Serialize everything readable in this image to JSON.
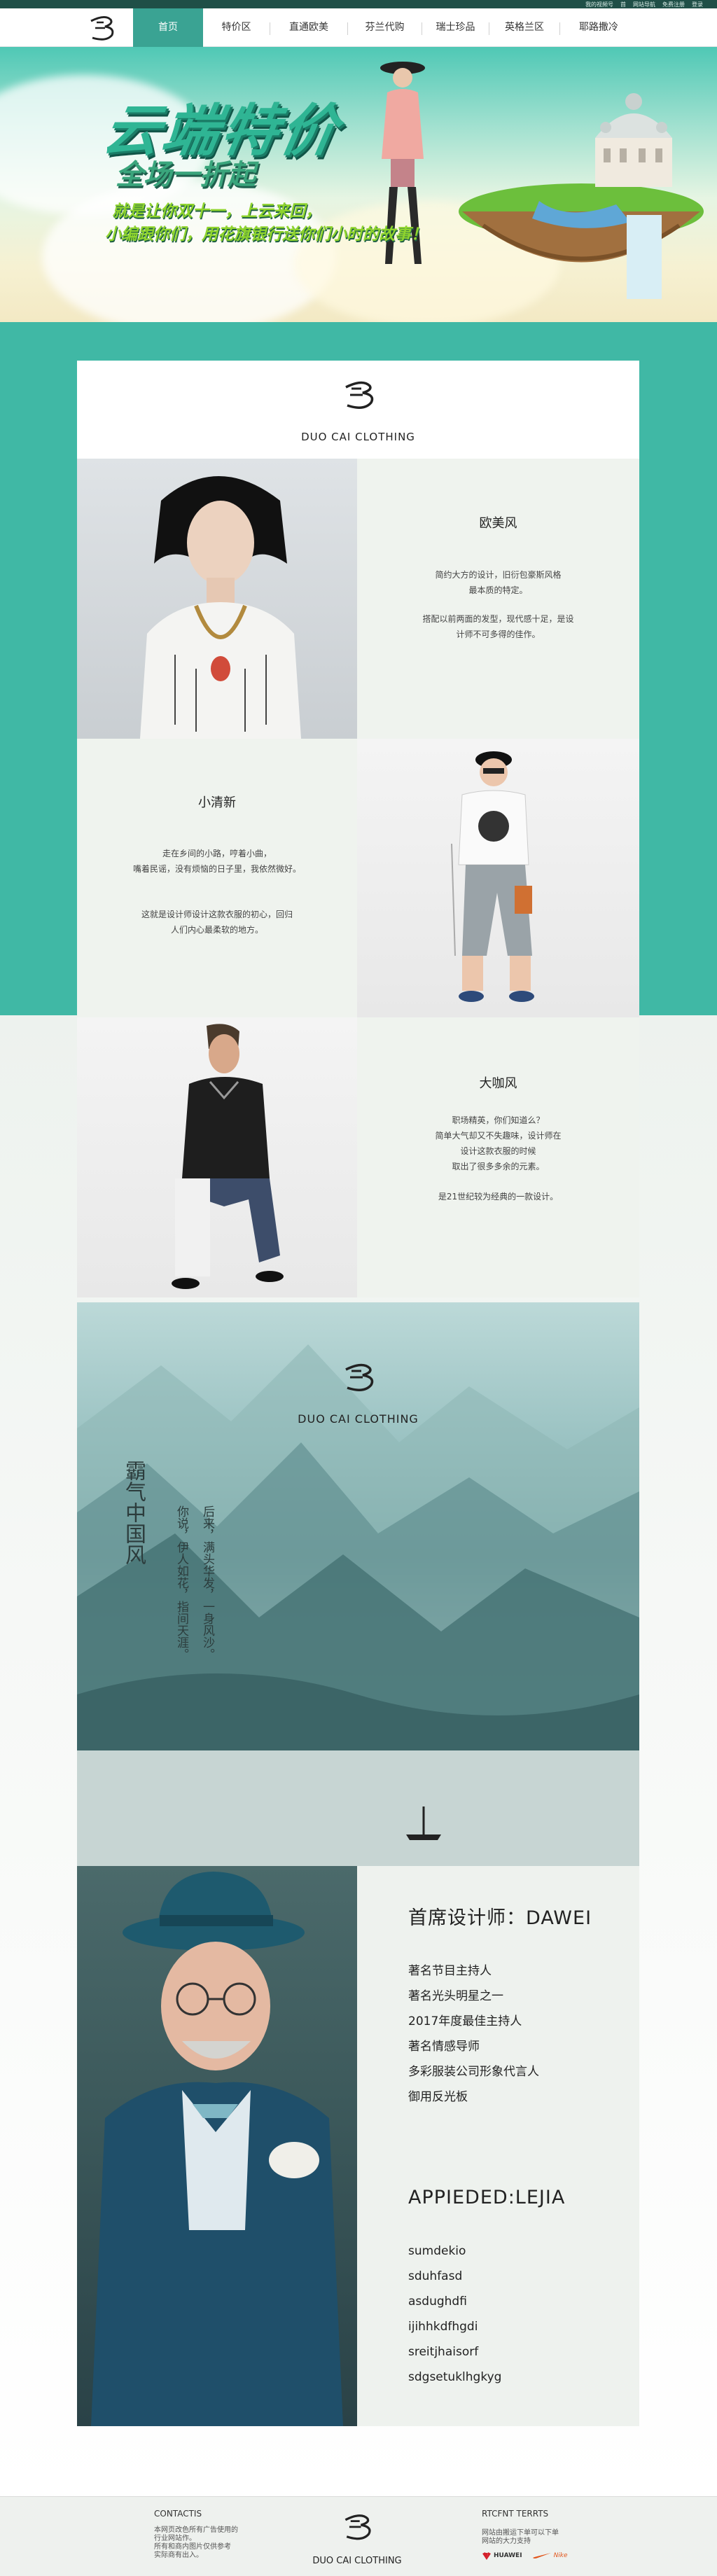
{
  "top_links": [
    "我的视频号",
    "首",
    "网站导航",
    "免费注册",
    "登录"
  ],
  "nav": {
    "logo_icon": "brand-logo-icon",
    "items": [
      "首页",
      "特价区",
      "直通欧美",
      "芬兰代购",
      "瑞士珍品",
      "英格兰区",
      "耶路撒冷"
    ],
    "active_index": 0
  },
  "banner": {
    "title": "云端特价",
    "subtitle": "全场一折起",
    "line1": "就是让你双十一，上云来回，",
    "line2": "小编跟你们，用花旗银行送你们小时的故事！"
  },
  "colors": {
    "accent": "#3aa393",
    "band": "#40b8a5",
    "panel": "#eff3ee"
  },
  "brand": {
    "name": "DUO CAI CLOTHING"
  },
  "sections": {
    "euro": {
      "title": "欧美风",
      "para1": "简约大方的设计，旧衍包豪斯风格\n最本质的特定。",
      "para2": "搭配以前两面的发型，现代感十足，是设\n计师不可多得的佳作。"
    },
    "fresh": {
      "title": "小清新",
      "para1": "走在乡间的小路，哼着小曲，\n嘴着民谣，没有烦恼的日子里，我依然微好。",
      "para2": "这就是设计师设计这款衣服的初心，回归\n人们内心最柔软的地方。"
    },
    "star": {
      "title": "大咖风",
      "para1": "职场精英，你们知道么？\n简单大气却又不失趣味，设计师在\n设计这款衣服的时候\n取出了很多多余的元素。",
      "para2": "是21世纪较为经典的一款设计。"
    }
  },
  "poster": {
    "brand": "DUO CAI CLOTHING",
    "main": "霸气中国风",
    "col1": "你说，伊人如花，指间天涯。",
    "col2": "后来，满头华发，一身风沙。"
  },
  "designer": {
    "title": "首席设计师：DAWEI",
    "roles": [
      "著名节目主持人",
      "著名光头明星之一",
      "2017年度最佳主持人",
      "著名情感导师",
      "多彩服装公司形象代言人",
      "御用反光板"
    ],
    "title2": "APPIEDED:LEJIA",
    "items": [
      "sumdekio",
      "sduhfasd",
      "asdughdfi",
      "ijihhkdfhgdi",
      "sreitjhaisorf",
      "sdgsetuklhgkyg"
    ]
  },
  "footer": {
    "contact_title": "CONTACTIS",
    "contact_lines": [
      "本网页改色所有广告使用的",
      "行业网站作。",
      "所有和商内图片仅供参考",
      "实际商有出入。"
    ],
    "brand": "DUO CAI CLOTHING",
    "right_title": "RTCFNT  TERRTS",
    "right_lines": [
      "网站由搬运下单可以下单",
      "网站的大力支持"
    ],
    "partners": [
      "HUAWEI",
      "Nike"
    ]
  }
}
